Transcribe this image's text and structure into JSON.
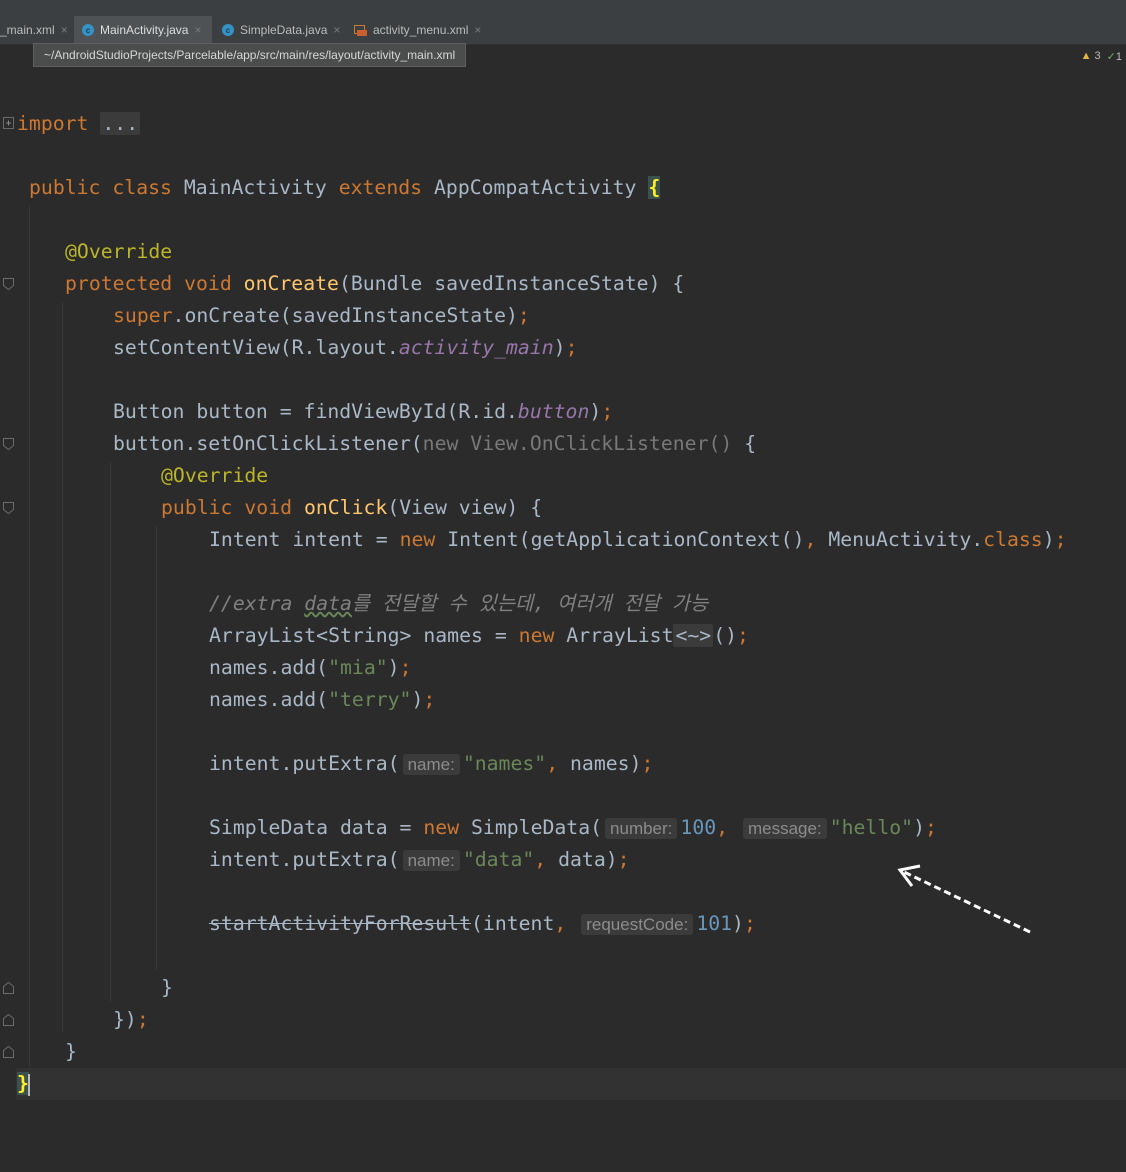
{
  "tabs": [
    {
      "label": "_main.xml",
      "icon": "xml-file-icon"
    },
    {
      "label": "MainActivity.java",
      "icon": "java-class-icon"
    },
    {
      "label": "SimpleData.java",
      "icon": "java-class-icon"
    },
    {
      "label": "activity_menu.xml",
      "icon": "xml-file-icon"
    }
  ],
  "tab_close_glyph": "×",
  "class_icon_glyph": "c",
  "tooltip": "~/AndroidStudioProjects/Parcelable/app/src/main/res/layout/activity_main.xml",
  "inspections": {
    "warnings": "3",
    "ok": "1"
  },
  "code": {
    "l1": {
      "kw": "import",
      "fold": "..."
    },
    "l2": {
      "kw1": "public",
      "kw2": "class",
      "name": "MainActivity",
      "kw3": "extends",
      "parent": "AppCompatActivity",
      "brace": "{"
    },
    "l3": {
      "ann": "@Override"
    },
    "l4": {
      "kw1": "protected",
      "kw2": "void",
      "fn": "onCreate",
      "args": "(Bundle savedInstanceState) {"
    },
    "l5": {
      "kw": "super",
      "rest": ".onCreate(savedInstanceState)",
      "semi": ";"
    },
    "l6": {
      "pre": "setContentView(R.layout.",
      "field": "activity_main",
      "post": ")",
      "semi": ";"
    },
    "l7": {
      "pre": "Button button = findViewById(R.id.",
      "field": "button",
      "post": ")",
      "semi": ";"
    },
    "l8": {
      "pre": "button.setOnClickListener(",
      "dim": "new View.OnClickListener()",
      "post": " {"
    },
    "l9": {
      "ann": "@Override"
    },
    "l10": {
      "kw1": "public",
      "kw2": "void",
      "fn": "onClick",
      "args": "(View view) {"
    },
    "l11": {
      "pre": "Intent intent = ",
      "kw": "new",
      "mid": " Intent(getApplicationContext()",
      "comma": ",",
      "post": " MenuActivity.",
      "kw2": "class",
      "end": ")",
      "semi": ";"
    },
    "l12": {
      "c1": "//extra ",
      "c2": "data",
      "c3": "를 전달할 수 있는데, 여러개 전달 가능"
    },
    "l13": {
      "pre": "ArrayList<String> names = ",
      "kw": "new",
      "mid": " ArrayList",
      "fold": "<~>",
      "post": "()",
      "semi": ";"
    },
    "l14": {
      "pre": "names.add(",
      "str": "\"mia\"",
      "post": ")",
      "semi": ";"
    },
    "l15": {
      "pre": "names.add(",
      "str": "\"terry\"",
      "post": ")",
      "semi": ";"
    },
    "l16": {
      "pre": "intent.putExtra(",
      "hint": "name:",
      "str": "\"names\"",
      "comma": ",",
      "post": " names)",
      "semi": ";"
    },
    "l17": {
      "pre": "SimpleData data = ",
      "kw": "new",
      "mid": " SimpleData(",
      "hint1": "number:",
      "num": "100",
      "comma": ",",
      "hint2": "message:",
      "str": "\"hello\"",
      "post": ")",
      "semi": ";"
    },
    "l18": {
      "pre": "intent.putExtra(",
      "hint": "name:",
      "str": "\"data\"",
      "comma": ",",
      "post": " data)",
      "semi": ";"
    },
    "l19": {
      "fn": "startActivityForResult",
      "pre": "(intent",
      "comma": ",",
      "hint": "requestCode:",
      "num": "101",
      "post": ")",
      "semi": ";"
    },
    "l20": {
      "text": "}"
    },
    "l21": {
      "text": "})",
      "semi": ";"
    },
    "l22": {
      "text": "}"
    },
    "l23": {
      "text": "}"
    }
  },
  "colors": {
    "background": "#2b2b2b",
    "keyword": "#cc7832",
    "annotation": "#bbb529",
    "method": "#ffc66d",
    "string": "#6a8759",
    "number": "#6897bb",
    "field": "#9876aa",
    "comment": "#808080",
    "text": "#a9b7c6"
  }
}
